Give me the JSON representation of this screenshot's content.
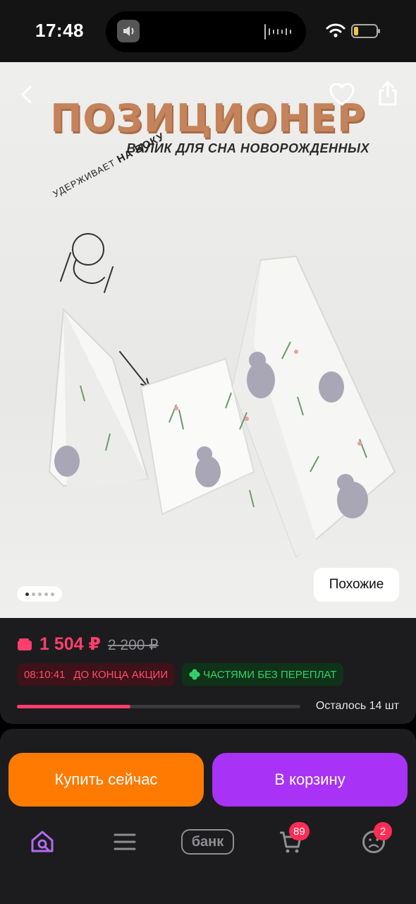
{
  "status_bar": {
    "time": "17:48"
  },
  "hero": {
    "title": "ПОЗИЦИОНЕР",
    "subtitle": "ВАЛИК ДЛЯ СНА НОВОРОЖДЕННЫХ",
    "badge_text_1": "УДЕРЖИВАЕТ",
    "badge_text_2": "НА БОКУ",
    "gallery_total": 5,
    "gallery_current": 1,
    "similar_label": "Похожие"
  },
  "pricing": {
    "price": "1 504 ₽",
    "old_price": "2 200 ₽",
    "timer": "08:10:41",
    "timer_label": "ДО КОНЦА АКЦИИ",
    "installments_label": "ЧАСТЯМИ БЕЗ ПЕРЕПЛАТ",
    "stock_text": "Осталось 14 шт",
    "stock_fraction": 0.4,
    "price_color": "#ff3e6c"
  },
  "actions": {
    "buy_now_label": "Купить сейчас",
    "add_to_cart_label": "В корзину",
    "buy_color": "#ff7a00",
    "cart_color": "#a832f5"
  },
  "tabbar": {
    "bank_label": "банк",
    "cart_badge": "89",
    "profile_badge": "2",
    "items": [
      "home-search-icon",
      "menu-icon",
      "bank-logo",
      "cart-icon",
      "profile-icon"
    ]
  }
}
